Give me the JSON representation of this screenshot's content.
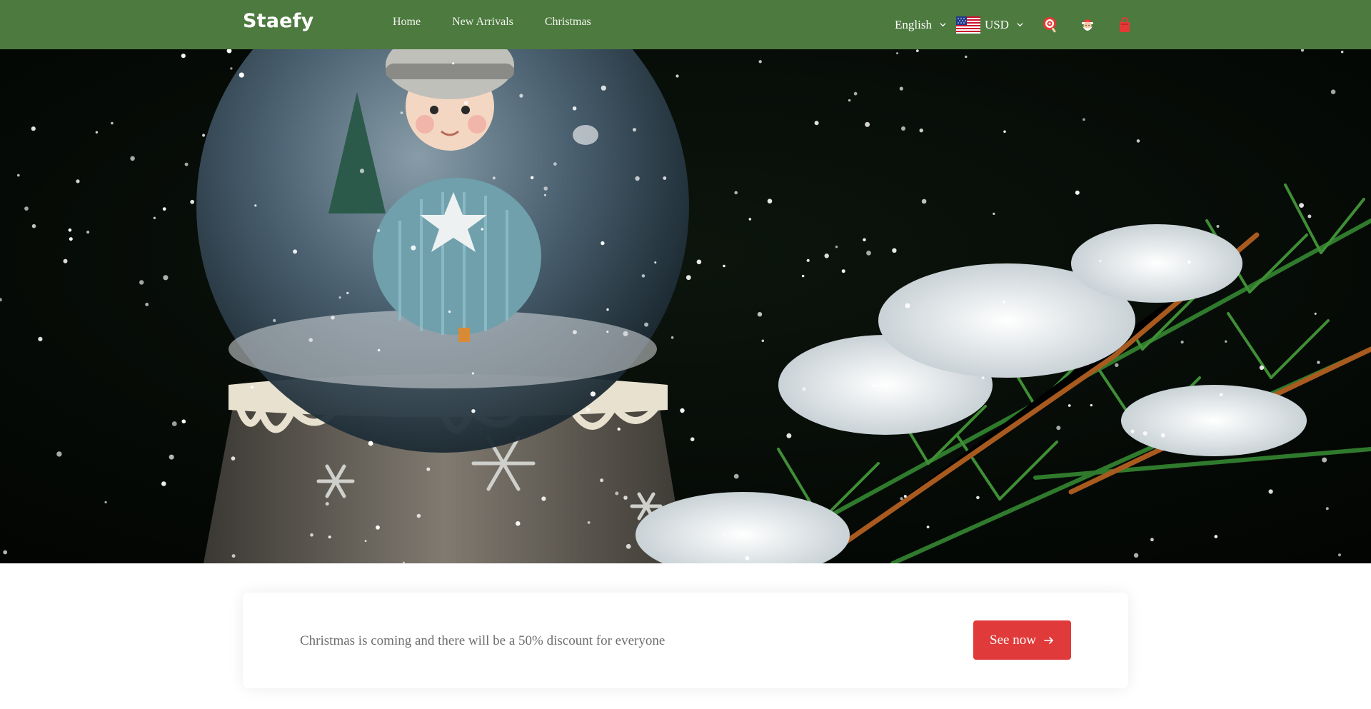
{
  "brand": {
    "logo": "Staefy"
  },
  "nav": {
    "items": [
      "Home",
      "New Arrivals",
      "Christmas"
    ]
  },
  "header": {
    "language": "English",
    "currency": "USD",
    "icons": [
      "lollipop-icon",
      "santa-icon",
      "shopping-bag-icon"
    ]
  },
  "banner": {
    "text": "Christmas is coming and there will be a 50% discount for everyone",
    "cta_label": "See now"
  },
  "colors": {
    "header_bg": "#4d7a3f",
    "cta_bg": "#e03a3a",
    "text_muted": "#6e6e6e"
  }
}
